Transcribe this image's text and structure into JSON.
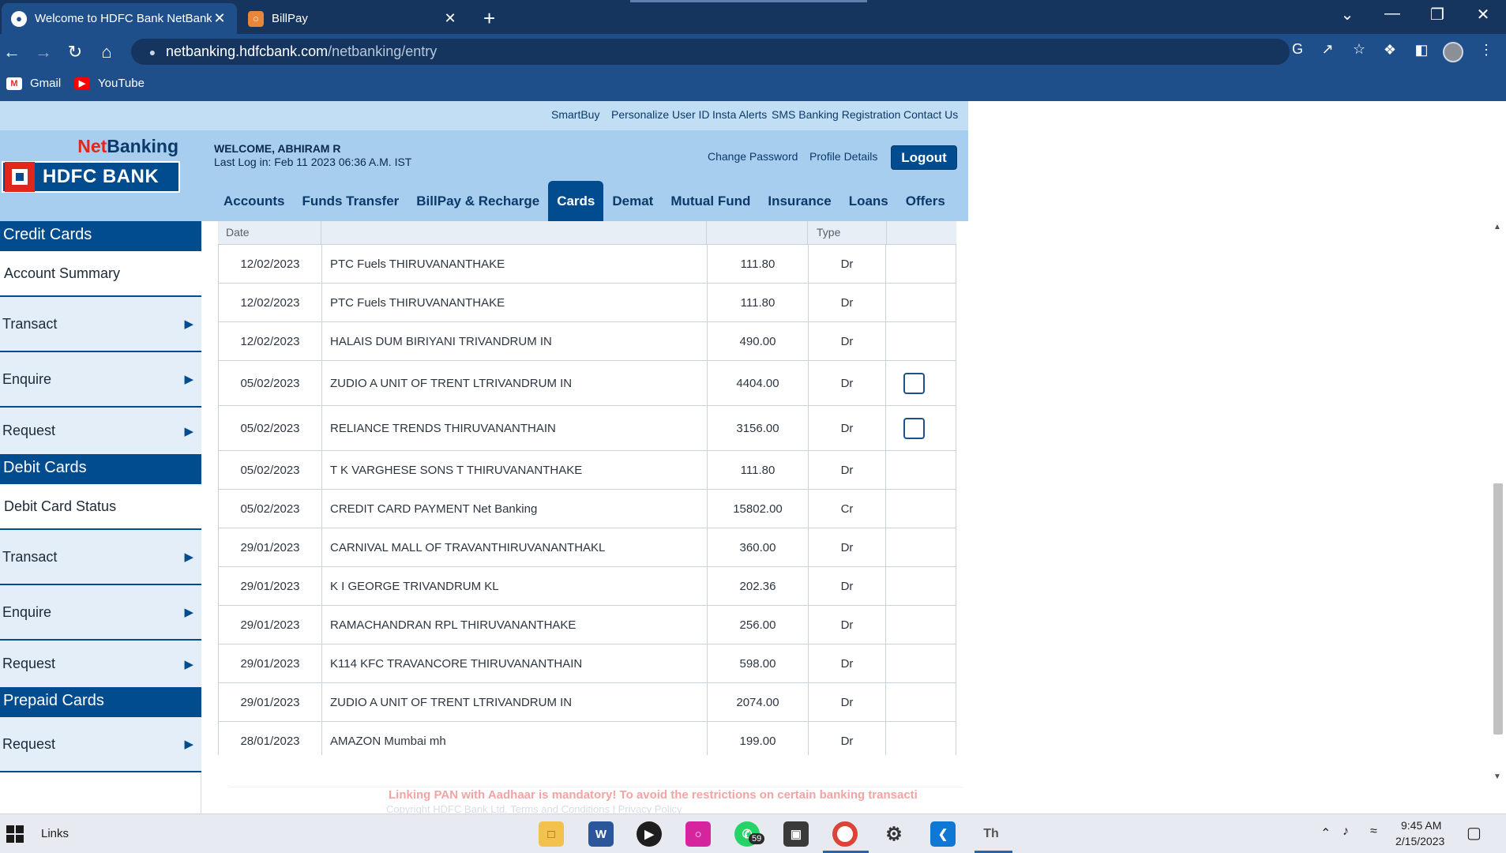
{
  "browser": {
    "tabs": [
      {
        "title": "Welcome to HDFC Bank NetBank",
        "active": true
      },
      {
        "title": "BillPay",
        "active": false
      }
    ],
    "url_host": "netbanking.hdfcbank.com",
    "url_path": "/netbanking/entry",
    "bookmarks": [
      {
        "label": "Gmail",
        "icon": "gmail-icon"
      },
      {
        "label": "YouTube",
        "icon": "youtube-icon"
      }
    ]
  },
  "header": {
    "top_links": [
      "SmartBuy",
      "Personalize User ID",
      "Insta Alerts",
      "SMS Banking Registration",
      "Contact Us"
    ],
    "logo_net": "Net",
    "logo_banking": "Banking",
    "logo_bank": "HDFC BANK",
    "welcome": "WELCOME, ABHIRAM R",
    "last_login": "Last Log in: Feb 11 2023 06:36 A.M. IST",
    "change_password": "Change Password",
    "profile_details": "Profile Details",
    "logout": "Logout",
    "nav": [
      {
        "label": "Accounts",
        "active": false
      },
      {
        "label": "Funds Transfer",
        "active": false
      },
      {
        "label": "BillPay & Recharge",
        "active": false
      },
      {
        "label": "Cards",
        "active": true
      },
      {
        "label": "Demat",
        "active": false
      },
      {
        "label": "Mutual Fund",
        "active": false
      },
      {
        "label": "Insurance",
        "active": false
      },
      {
        "label": "Loans",
        "active": false
      },
      {
        "label": "Offers",
        "active": false
      }
    ]
  },
  "sidebar": {
    "credit_head": "Credit Cards",
    "credit_items": [
      "Account Summary",
      "Transact",
      "Enquire",
      "Request"
    ],
    "debit_head": "Debit Cards",
    "debit_items": [
      "Debit Card Status",
      "Transact",
      "Enquire",
      "Request"
    ],
    "prepaid_head": "Prepaid Cards",
    "prepaid_items": [
      "Request"
    ]
  },
  "table": {
    "col_date": "Date",
    "col_type": "Type",
    "rows": [
      {
        "date": "12/02/2023",
        "desc": "PTC Fuels THIRUVANANTHAKE",
        "amount": "111.80",
        "type": "Dr",
        "checkbox": false
      },
      {
        "date": "12/02/2023",
        "desc": "PTC Fuels THIRUVANANTHAKE",
        "amount": "111.80",
        "type": "Dr",
        "checkbox": false
      },
      {
        "date": "12/02/2023",
        "desc": "HALAIS DUM BIRIYANI TRIVANDRUM IN",
        "amount": "490.00",
        "type": "Dr",
        "checkbox": false
      },
      {
        "date": "05/02/2023",
        "desc": "ZUDIO A UNIT OF TRENT LTRIVANDRUM IN",
        "amount": "4404.00",
        "type": "Dr",
        "checkbox": true
      },
      {
        "date": "05/02/2023",
        "desc": "RELIANCE TRENDS THIRUVANANTHAIN",
        "amount": "3156.00",
        "type": "Dr",
        "checkbox": true
      },
      {
        "date": "05/02/2023",
        "desc": "T K VARGHESE SONS T THIRUVANANTHAKE",
        "amount": "111.80",
        "type": "Dr",
        "checkbox": false
      },
      {
        "date": "05/02/2023",
        "desc": "CREDIT CARD PAYMENT Net Banking",
        "amount": "15802.00",
        "type": "Cr",
        "checkbox": false
      },
      {
        "date": "29/01/2023",
        "desc": "CARNIVAL MALL OF TRAVANTHIRUVANANTHAKL",
        "amount": "360.00",
        "type": "Dr",
        "checkbox": false
      },
      {
        "date": "29/01/2023",
        "desc": "K I GEORGE TRIVANDRUM KL",
        "amount": "202.36",
        "type": "Dr",
        "checkbox": false
      },
      {
        "date": "29/01/2023",
        "desc": "RAMACHANDRAN RPL THIRUVANANTHAKE",
        "amount": "256.00",
        "type": "Dr",
        "checkbox": false
      },
      {
        "date": "29/01/2023",
        "desc": "K114 KFC TRAVANCORE THIRUVANANTHAIN",
        "amount": "598.00",
        "type": "Dr",
        "checkbox": false
      },
      {
        "date": "29/01/2023",
        "desc": "ZUDIO A UNIT OF TRENT LTRIVANDRUM IN",
        "amount": "2074.00",
        "type": "Dr",
        "checkbox": false
      },
      {
        "date": "28/01/2023",
        "desc": "AMAZON Mumbai mh",
        "amount": "199.00",
        "type": "Dr",
        "checkbox": false
      }
    ]
  },
  "footer": {
    "notice": "Linking PAN with Aadhaar is mandatory! To avoid the restrictions on certain banking transacti",
    "copyright": "Copyright HDFC Bank Ltd. Terms and Conditions | Privacy Policy"
  },
  "taskbar": {
    "search_label": "Links",
    "whatsapp_badge": "59",
    "time": "9:45 AM",
    "date": "2/15/2023"
  }
}
